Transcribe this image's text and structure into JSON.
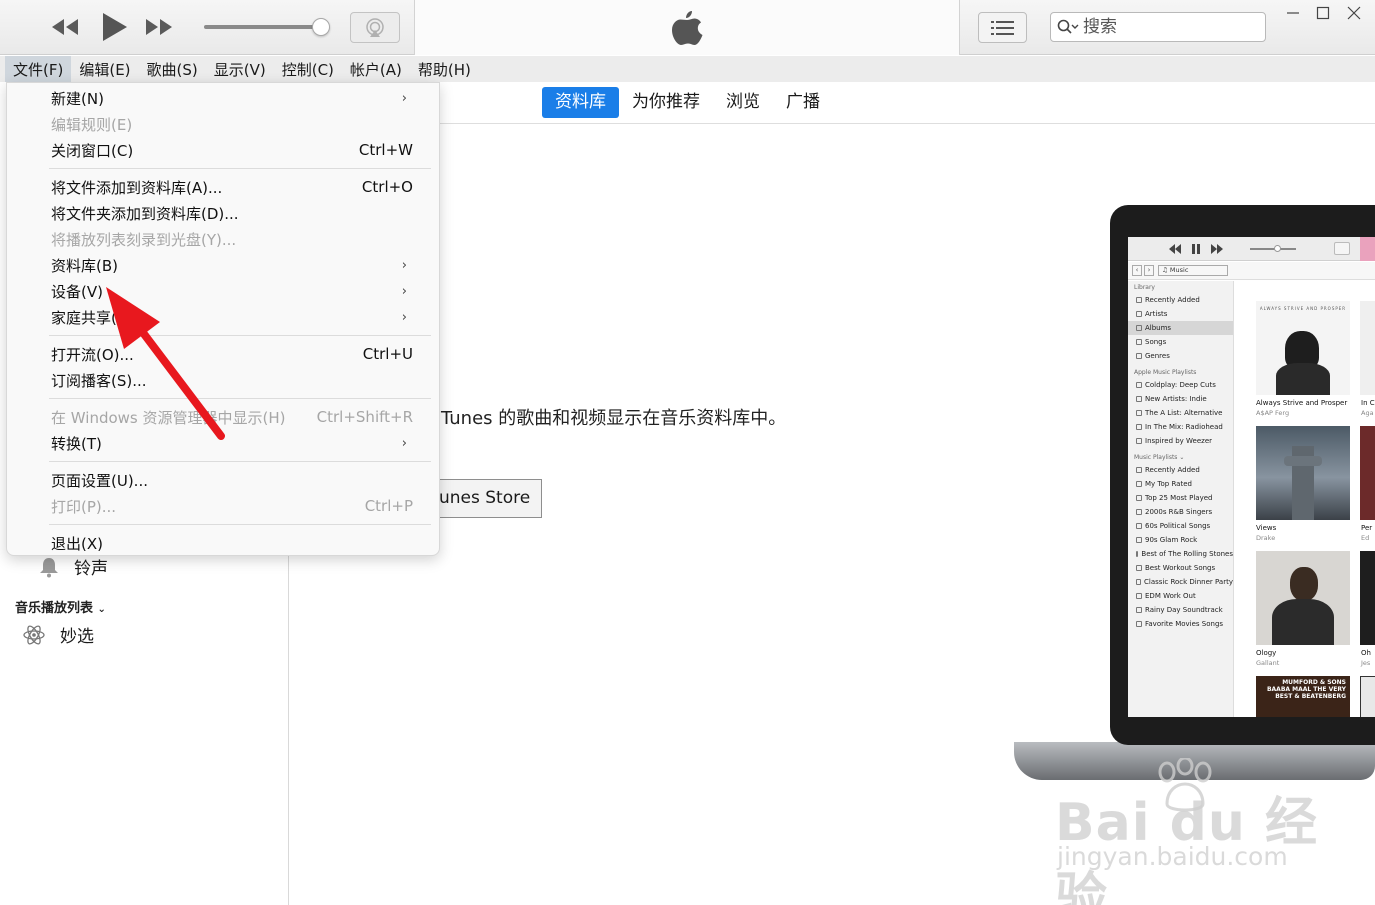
{
  "window": {
    "search_placeholder": "搜索"
  },
  "menubar": {
    "items": [
      "文件(F)",
      "编辑(E)",
      "歌曲(S)",
      "显示(V)",
      "控制(C)",
      "帐户(A)",
      "帮助(H)"
    ],
    "active_index": 0
  },
  "tabs": {
    "items": [
      "资料库",
      "为你推荐",
      "浏览",
      "广播"
    ],
    "active_index": 0,
    "accent": "#1a7ee8"
  },
  "file_menu": {
    "items": [
      {
        "label": "新建(N)",
        "shortcut": "",
        "submenu": true,
        "disabled": false
      },
      {
        "label": "编辑规则(E)",
        "shortcut": "",
        "submenu": false,
        "disabled": true
      },
      {
        "label": "关闭窗口(C)",
        "shortcut": "Ctrl+W",
        "submenu": false,
        "disabled": false
      },
      {
        "label": "将文件添加到资料库(A)...",
        "shortcut": "Ctrl+O",
        "submenu": false,
        "disabled": false
      },
      {
        "label": "将文件夹添加到资料库(D)...",
        "shortcut": "",
        "submenu": false,
        "disabled": false
      },
      {
        "label": "将播放列表刻录到光盘(Y)...",
        "shortcut": "",
        "submenu": false,
        "disabled": true
      },
      {
        "label": "资料库(B)",
        "shortcut": "",
        "submenu": true,
        "disabled": false
      },
      {
        "label": "设备(V)",
        "shortcut": "",
        "submenu": true,
        "disabled": false
      },
      {
        "label": "家庭共享(",
        "shortcut": "",
        "submenu": true,
        "disabled": false
      },
      {
        "label": "打开流(O)...",
        "shortcut": "Ctrl+U",
        "submenu": false,
        "disabled": false
      },
      {
        "label": "订阅播客(S)...",
        "shortcut": "",
        "submenu": false,
        "disabled": false
      },
      {
        "label": "在 Windows 资源管理器中显示(H)",
        "shortcut": "Ctrl+Shift+R",
        "submenu": false,
        "disabled": true
      },
      {
        "label": "转换(T)",
        "shortcut": "",
        "submenu": true,
        "disabled": false
      },
      {
        "label": "页面设置(U)...",
        "shortcut": "",
        "submenu": false,
        "disabled": false
      },
      {
        "label": "打印(P)...",
        "shortcut": "Ctrl+P",
        "submenu": false,
        "disabled": true
      },
      {
        "label": "退出(X)",
        "shortcut": "",
        "submenu": false,
        "disabled": false
      }
    ]
  },
  "sidebar": {
    "ringtones_label": "铃声",
    "music_playlists_header": "音乐播放列表",
    "genius_label": "妙选"
  },
  "main": {
    "heading_fragment": "：",
    "description": "iTunes 的歌曲和视频显示在音乐资料库中。",
    "store_button": "unes Store"
  },
  "laptop_screen": {
    "source_label": "Music",
    "library_header": "Library",
    "library_items": [
      "Recently Added",
      "Artists",
      "Albums",
      "Songs",
      "Genres"
    ],
    "apple_playlists_header": "Apple Music Playlists",
    "apple_playlists": [
      "Coldplay: Deep Cuts",
      "New Artists: Indie",
      "The A List: Alternative",
      "In The Mix: Radiohead",
      "Inspired by Weezer"
    ],
    "music_playlists_header": "Music Playlists ⌄",
    "music_playlists": [
      "Recently Added",
      "My Top Rated",
      "Top 25 Most Played",
      "2000s R&B Singers",
      "60s Political Songs",
      "90s Glam Rock",
      "Best of The Rolling Stones",
      "Best Workout Songs",
      "Classic Rock Dinner Party",
      "EDM Work Out",
      "Rainy Day Soundtrack",
      "Favorite Movies Songs"
    ],
    "albums": [
      {
        "title": "Always Strive and Prosper",
        "artist": "A$AP Ferg",
        "cover_text": "ALWAYS STRIVE AND PROSPER"
      },
      {
        "title": "Views",
        "artist": "Drake"
      },
      {
        "title": "Ology",
        "artist": "Gallant"
      },
      {
        "title": "",
        "artist": "",
        "cover_text": "MUMFORD & SONS BAABA MAAL THE VERY BEST & BEATENBERG"
      }
    ],
    "edge_titles": [
      "In C",
      "Per",
      "Oh"
    ],
    "edge_artists": [
      "Aga",
      "Ed",
      "Jes"
    ]
  },
  "watermark": {
    "brand": "Bai du 经验",
    "url": "jingyan.baidu.com"
  },
  "annotation": {
    "arrow_color": "#e8181e"
  }
}
